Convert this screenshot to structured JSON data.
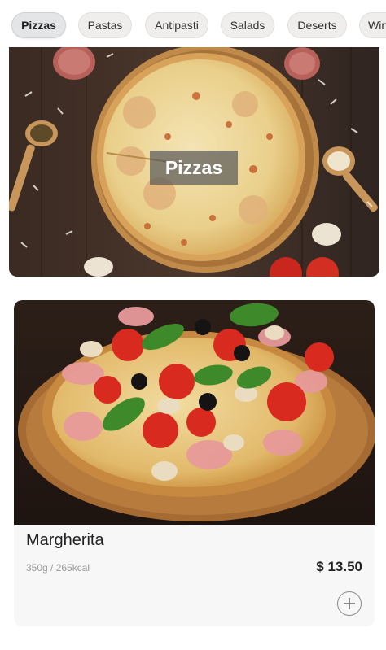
{
  "categories": [
    {
      "label": "Pizzas",
      "active": true
    },
    {
      "label": "Pastas"
    },
    {
      "label": "Antipasti"
    },
    {
      "label": "Salads"
    },
    {
      "label": "Deserts"
    },
    {
      "label": "Wine"
    }
  ],
  "hero": {
    "label": "Pizzas"
  },
  "product": {
    "name": "Margherita",
    "meta": "350g / 265kcal",
    "price": "$ 13.50",
    "add_icon": "plus-circle-icon"
  }
}
